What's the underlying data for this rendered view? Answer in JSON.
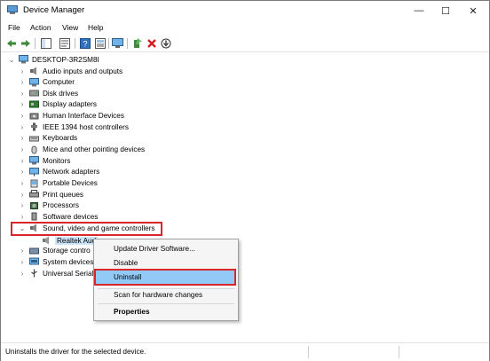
{
  "window": {
    "title": "Device Manager",
    "minimize": "—",
    "maximize": "☐",
    "close": "✕"
  },
  "menu": [
    "File",
    "Action",
    "View",
    "Help"
  ],
  "toolbar": {
    "icons": [
      "back-icon",
      "forward-icon",
      "show-hide-tree-icon",
      "properties-icon",
      "help-icon",
      "view-toggle-icon",
      "monitor-icon",
      "update-driver-icon",
      "uninstall-icon",
      "disable-icon"
    ]
  },
  "tree": {
    "root": "DESKTOP-3R2SM8I",
    "categories": [
      {
        "label": "Audio inputs and outputs",
        "icon": "audio-icon"
      },
      {
        "label": "Computer",
        "icon": "computer-icon"
      },
      {
        "label": "Disk drives",
        "icon": "disk-icon"
      },
      {
        "label": "Display adapters",
        "icon": "display-icon"
      },
      {
        "label": "Human Interface Devices",
        "icon": "hid-icon"
      },
      {
        "label": "IEEE 1394 host controllers",
        "icon": "ieee1394-icon"
      },
      {
        "label": "Keyboards",
        "icon": "keyboard-icon"
      },
      {
        "label": "Mice and other pointing devices",
        "icon": "mouse-icon"
      },
      {
        "label": "Monitors",
        "icon": "monitor-icon"
      },
      {
        "label": "Network adapters",
        "icon": "network-icon"
      },
      {
        "label": "Portable Devices",
        "icon": "portable-icon"
      },
      {
        "label": "Print queues",
        "icon": "printer-icon"
      },
      {
        "label": "Processors",
        "icon": "processor-icon"
      },
      {
        "label": "Software devices",
        "icon": "software-icon"
      },
      {
        "label": "Sound, video and game controllers",
        "icon": "sound-icon",
        "expanded": true
      },
      {
        "label": "Storage contro",
        "icon": "storage-icon"
      },
      {
        "label": "System devices",
        "icon": "system-icon"
      },
      {
        "label": "Universal Serial",
        "icon": "usb-icon"
      }
    ],
    "child": {
      "label": "Realtek Aud"
    }
  },
  "context_menu": {
    "items": [
      {
        "label": "Update Driver Software..."
      },
      {
        "label": "Disable"
      },
      {
        "label": "Uninstall",
        "highlighted": true
      },
      {
        "label": "Scan for hardware changes"
      },
      {
        "label": "Properties",
        "bold": true
      }
    ]
  },
  "status": {
    "text": "Uninstalls the driver for the selected device."
  },
  "colors": {
    "highlight": "#91c9f7",
    "annotation_red": "#d9262a"
  }
}
